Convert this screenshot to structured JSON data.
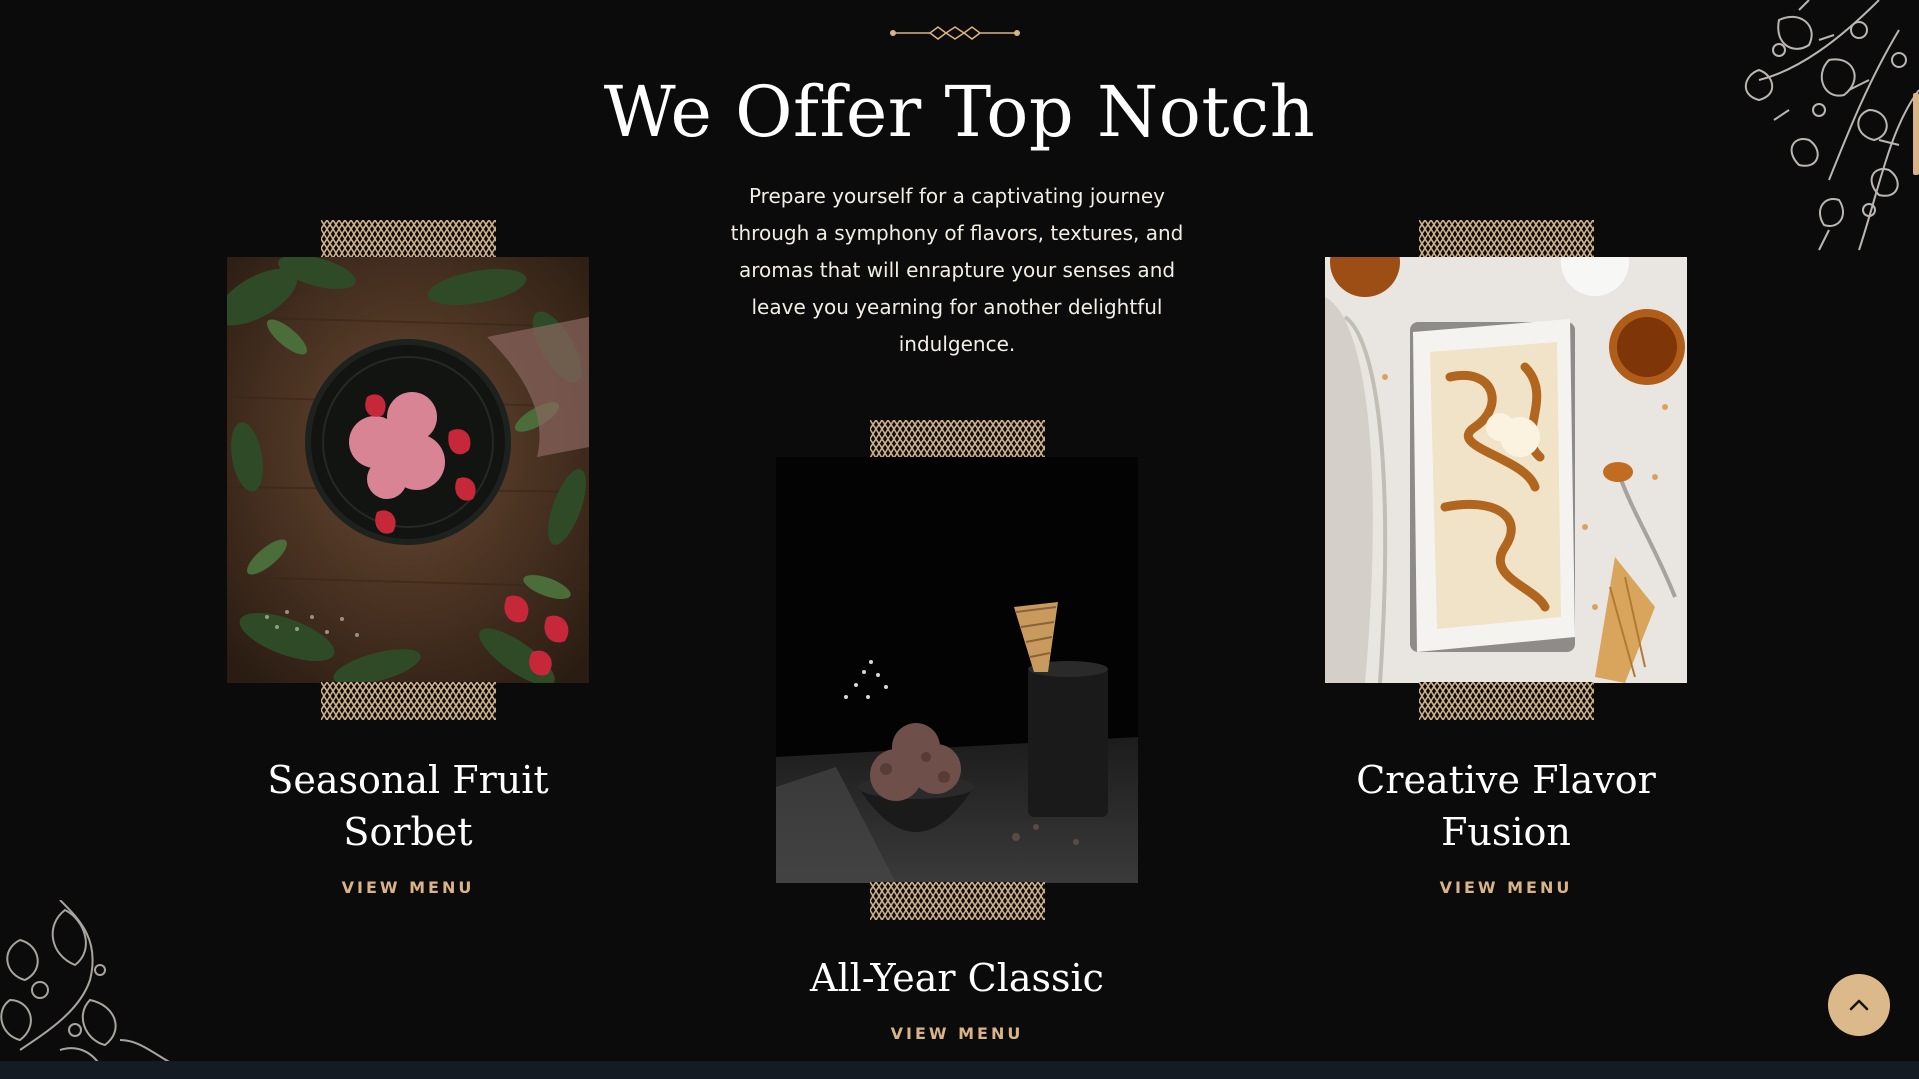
{
  "section": {
    "title": "We Offer Top Notch",
    "intro": "Prepare yourself for a captivating journey through a symphony of flavors, textures, and aromas that will enrapture your senses and leave you yearning for another delightful indulgence."
  },
  "cards": [
    {
      "name_line1": "Seasonal Fruit",
      "name_line2": "Sorbet",
      "link": "VIEW MENU",
      "photo": "strawberry-sorbet-photo"
    },
    {
      "name_line1": "All-Year Classic",
      "link": "VIEW MENU",
      "photo": "chocolate-ice-cream-photo"
    },
    {
      "name_line1": "Creative Flavor",
      "name_line2": "Fusion",
      "link": "VIEW MENU",
      "photo": "caramel-swirl-ice-cream-photo"
    }
  ],
  "icons": {
    "divider": "ornament-divider-icon",
    "pattern": "geometric-pattern-icon",
    "scroll_top": "chevron-up-icon",
    "floral": "floral-illustration-icon"
  },
  "colors": {
    "background": "#0c0b0b",
    "accent": "#d8b487",
    "scroll_button": "#dcb98b",
    "text": "#ffffff",
    "bottom_bar": "#151b22"
  }
}
